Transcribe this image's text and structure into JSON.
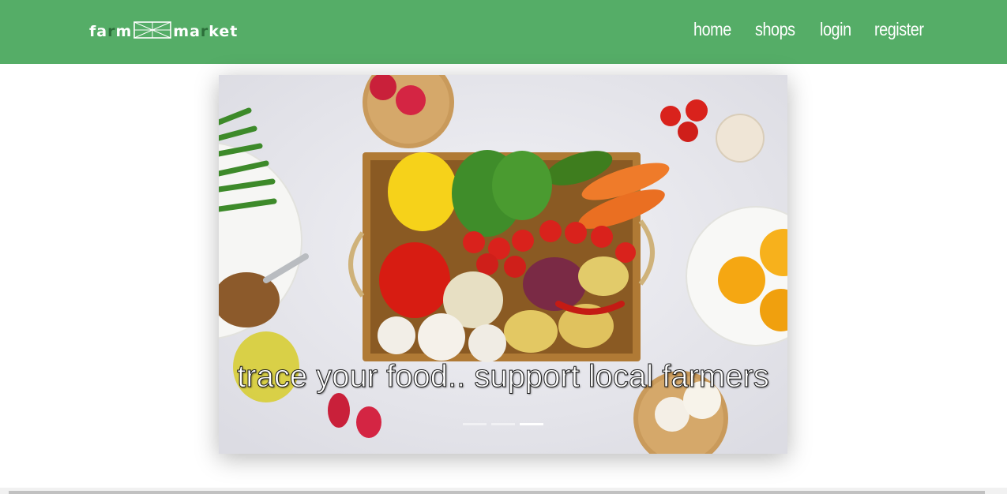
{
  "brand": {
    "part1": "fa",
    "part1_accent": "r",
    "part2": "m",
    "part3": "ma",
    "part3_accent": "r",
    "part4": "ket",
    "color": "#55ad67"
  },
  "nav": {
    "items": [
      {
        "label": "home"
      },
      {
        "label": "shops"
      },
      {
        "label": "login"
      },
      {
        "label": "register"
      }
    ]
  },
  "carousel": {
    "caption": "trace your food.. support local farmers",
    "slide_count": 3,
    "active_index": 2
  }
}
